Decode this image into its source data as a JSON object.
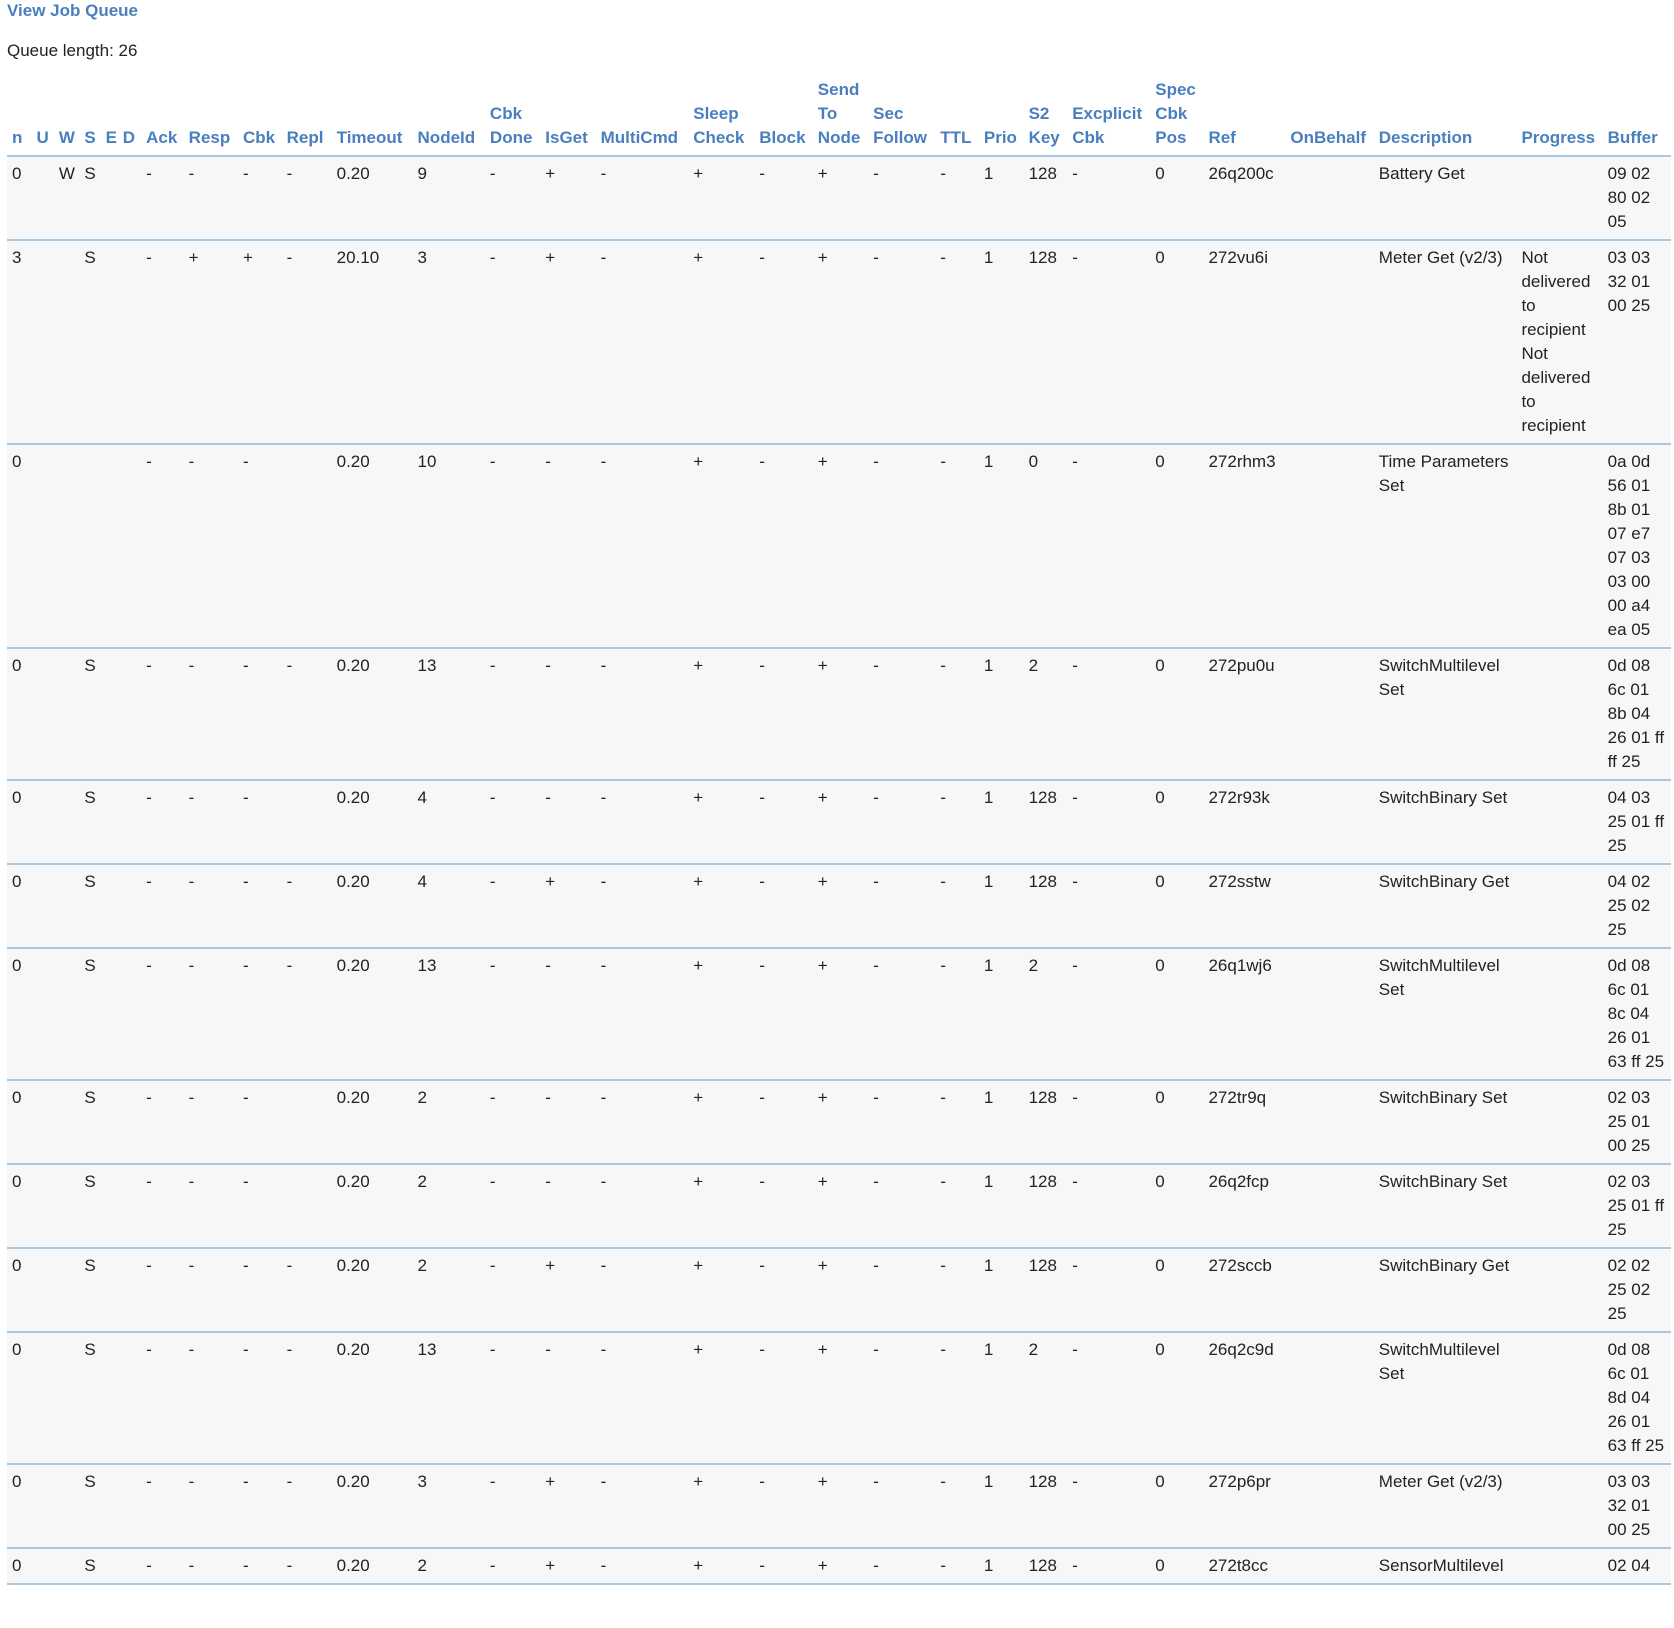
{
  "page": {
    "title": "View Job Queue",
    "queue_length": "Queue length: 26"
  },
  "columns": [
    "n",
    "U",
    "W",
    "S",
    "E",
    "D",
    "Ack",
    "Resp",
    "Cbk",
    "Repl",
    "Timeout",
    "NodeId",
    "Cbk Done",
    "IsGet",
    "MultiCmd",
    "Sleep Check",
    "Block",
    "Send To Node",
    "Sec Follow",
    "TTL",
    "Prio",
    "S2 Key",
    "Excplicit Cbk",
    "Spec Cbk Pos",
    "Ref",
    "OnBehalf",
    "Description",
    "Progress",
    "Buffer"
  ],
  "rows": [
    [
      "0",
      "",
      "W",
      "S",
      "",
      "",
      "-",
      "-",
      "-",
      "-",
      "0.20",
      "9",
      "-",
      "+",
      "-",
      "+",
      "-",
      "+",
      "-",
      "-",
      "1",
      "128",
      "-",
      "0",
      "26q200c",
      "",
      "Battery Get",
      "",
      "09 02 80 02 05"
    ],
    [
      "3",
      "",
      "",
      "S",
      "",
      "",
      "-",
      "+",
      "+",
      "-",
      "20.10",
      "3",
      "-",
      "+",
      "-",
      "+",
      "-",
      "+",
      "-",
      "-",
      "1",
      "128",
      "-",
      "0",
      "272vu6i",
      "",
      "Meter Get (v2/3)",
      "Not delivered to recipient Not delivered to recipient",
      "03 03 32 01 00 25"
    ],
    [
      "0",
      "",
      "",
      "",
      "",
      "",
      "-",
      "-",
      "-",
      "",
      "0.20",
      "10",
      "-",
      "-",
      "-",
      "+",
      "-",
      "+",
      "-",
      "-",
      "1",
      "0",
      "-",
      "0",
      "272rhm3",
      "",
      "Time Parameters Set",
      "",
      "0a 0d 56 01 8b 01 07 e7 07 03 03 00 00 a4 ea 05"
    ],
    [
      "0",
      "",
      "",
      "S",
      "",
      "",
      "-",
      "-",
      "-",
      "-",
      "0.20",
      "13",
      "-",
      "-",
      "-",
      "+",
      "-",
      "+",
      "-",
      "-",
      "1",
      "2",
      "-",
      "0",
      "272pu0u",
      "",
      "SwitchMultilevel Set",
      "",
      "0d 08 6c 01 8b 04 26 01 ff ff 25"
    ],
    [
      "0",
      "",
      "",
      "S",
      "",
      "",
      "-",
      "-",
      "-",
      "",
      "0.20",
      "4",
      "-",
      "-",
      "-",
      "+",
      "-",
      "+",
      "-",
      "-",
      "1",
      "128",
      "-",
      "0",
      "272r93k",
      "",
      "SwitchBinary Set",
      "",
      "04 03 25 01 ff 25"
    ],
    [
      "0",
      "",
      "",
      "S",
      "",
      "",
      "-",
      "-",
      "-",
      "-",
      "0.20",
      "4",
      "-",
      "+",
      "-",
      "+",
      "-",
      "+",
      "-",
      "-",
      "1",
      "128",
      "-",
      "0",
      "272sstw",
      "",
      "SwitchBinary Get",
      "",
      "04 02 25 02 25"
    ],
    [
      "0",
      "",
      "",
      "S",
      "",
      "",
      "-",
      "-",
      "-",
      "-",
      "0.20",
      "13",
      "-",
      "-",
      "-",
      "+",
      "-",
      "+",
      "-",
      "-",
      "1",
      "2",
      "-",
      "0",
      "26q1wj6",
      "",
      "SwitchMultilevel Set",
      "",
      "0d 08 6c 01 8c 04 26 01 63 ff 25"
    ],
    [
      "0",
      "",
      "",
      "S",
      "",
      "",
      "-",
      "-",
      "-",
      "",
      "0.20",
      "2",
      "-",
      "-",
      "-",
      "+",
      "-",
      "+",
      "-",
      "-",
      "1",
      "128",
      "-",
      "0",
      "272tr9q",
      "",
      "SwitchBinary Set",
      "",
      "02 03 25 01 00 25"
    ],
    [
      "0",
      "",
      "",
      "S",
      "",
      "",
      "-",
      "-",
      "-",
      "",
      "0.20",
      "2",
      "-",
      "-",
      "-",
      "+",
      "-",
      "+",
      "-",
      "-",
      "1",
      "128",
      "-",
      "0",
      "26q2fcp",
      "",
      "SwitchBinary Set",
      "",
      "02 03 25 01 ff 25"
    ],
    [
      "0",
      "",
      "",
      "S",
      "",
      "",
      "-",
      "-",
      "-",
      "-",
      "0.20",
      "2",
      "-",
      "+",
      "-",
      "+",
      "-",
      "+",
      "-",
      "-",
      "1",
      "128",
      "-",
      "0",
      "272sccb",
      "",
      "SwitchBinary Get",
      "",
      "02 02 25 02 25"
    ],
    [
      "0",
      "",
      "",
      "S",
      "",
      "",
      "-",
      "-",
      "-",
      "-",
      "0.20",
      "13",
      "-",
      "-",
      "-",
      "+",
      "-",
      "+",
      "-",
      "-",
      "1",
      "2",
      "-",
      "0",
      "26q2c9d",
      "",
      "SwitchMultilevel Set",
      "",
      "0d 08 6c 01 8d 04 26 01 63 ff 25"
    ],
    [
      "0",
      "",
      "",
      "S",
      "",
      "",
      "-",
      "-",
      "-",
      "-",
      "0.20",
      "3",
      "-",
      "+",
      "-",
      "+",
      "-",
      "+",
      "-",
      "-",
      "1",
      "128",
      "-",
      "0",
      "272p6pr",
      "",
      "Meter Get (v2/3)",
      "",
      "03 03 32 01 00 25"
    ],
    [
      "0",
      "",
      "",
      "S",
      "",
      "",
      "-",
      "-",
      "-",
      "-",
      "0.20",
      "2",
      "-",
      "+",
      "-",
      "+",
      "-",
      "+",
      "-",
      "-",
      "1",
      "128",
      "-",
      "0",
      "272t8cc",
      "",
      "SensorMultilevel",
      "",
      "02 04"
    ]
  ]
}
